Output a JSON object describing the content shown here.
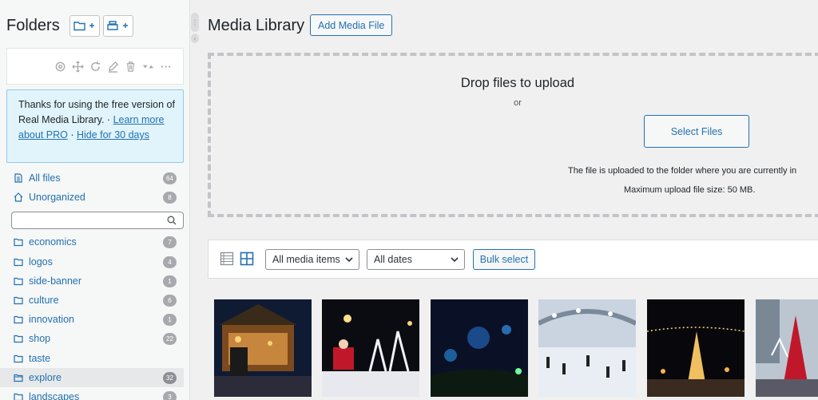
{
  "sidebar": {
    "title": "Folders",
    "notice": {
      "text": "Thanks for using the free version of Real Media Library. · ",
      "learn_more": "Learn more about PRO",
      "separator": " · ",
      "hide": "Hide for 30 days"
    },
    "all_files": {
      "label": "All files",
      "count": "64"
    },
    "unorganized": {
      "label": "Unorganized",
      "count": "8"
    },
    "search": {
      "value": "",
      "placeholder": ""
    },
    "folders": [
      {
        "label": "economics",
        "count": "7"
      },
      {
        "label": "logos",
        "count": "4"
      },
      {
        "label": "side-banner",
        "count": "1"
      },
      {
        "label": "culture",
        "count": "6"
      },
      {
        "label": "innovation",
        "count": "1"
      },
      {
        "label": "shop",
        "count": "22"
      },
      {
        "label": "taste",
        "count": ""
      },
      {
        "label": "explore",
        "count": "32"
      },
      {
        "label": "landscapes",
        "count": "3"
      }
    ],
    "active_folder": "explore"
  },
  "main": {
    "title": "Media Library",
    "add_button": "Add Media File",
    "dropzone": {
      "title": "Drop files to upload",
      "or": "or",
      "select_button": "Select Files",
      "info_folder": "The file is uploaded to the folder where you are currently in",
      "info_max": "Maximum upload file size: 50 MB."
    },
    "filters": {
      "media_type": "All media items",
      "dates": "All dates",
      "bulk_select": "Bulk select"
    }
  },
  "colors": {
    "link": "#2271b1",
    "badge": "#a7aaad",
    "notice_bg": "#e1f4fc",
    "notice_border": "#8ecbe6"
  },
  "icons": [
    "add-folder-icon",
    "add-collection-icon",
    "settings-icon",
    "move-icon",
    "refresh-icon",
    "edit-icon",
    "trash-icon",
    "sort-icon",
    "more-icon",
    "folder-icon",
    "home-icon",
    "search-icon",
    "list-view-icon",
    "grid-view-icon",
    "chevron-down-icon"
  ]
}
